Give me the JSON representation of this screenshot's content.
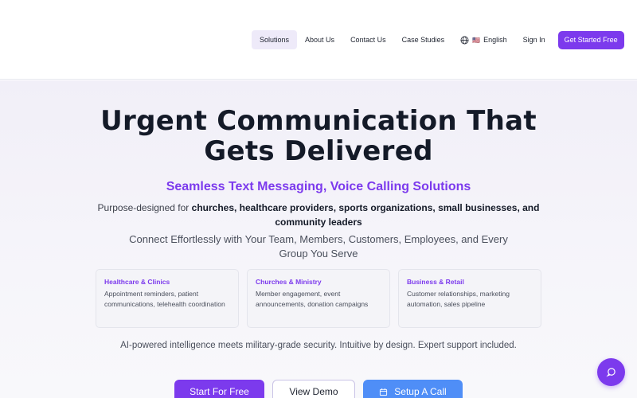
{
  "nav": {
    "items": [
      {
        "label": "Solutions",
        "active": true
      },
      {
        "label": "About Us"
      },
      {
        "label": "Contact Us"
      },
      {
        "label": "Case Studies"
      }
    ],
    "language": {
      "label": "English",
      "flag": "🇺🇸"
    },
    "sign_in": "Sign In",
    "get_started": "Get Started Free"
  },
  "hero": {
    "title_line1": "Urgent Communication That",
    "title_line2": "Gets Delivered",
    "subtitle": "Seamless Text Messaging, Voice Calling Solutions",
    "purpose_prefix": "Purpose-designed for",
    "purpose_bold": "churches, healthcare providers, sports organizations, small businesses, and community leaders",
    "connect": "Connect Effortlessly with Your Team, Members, Customers, Employees, and Every Group You Serve",
    "cards": [
      {
        "title": "Healthcare & Clinics",
        "desc": "Appointment reminders, patient communications, telehealth coordination"
      },
      {
        "title": "Churches & Ministry",
        "desc": "Member engagement, event announcements, donation campaigns"
      },
      {
        "title": "Business & Retail",
        "desc": "Customer relationships, marketing automation, sales pipeline"
      }
    ],
    "ai_text": "AI-powered intelligence meets military-grade security. Intuitive by design. Expert support included.",
    "buttons": {
      "start": "Start For Free",
      "demo": "View Demo",
      "call": "Setup A Call"
    }
  },
  "colors": {
    "accent": "#7c3aed",
    "call_button": "#4f8ef7"
  },
  "icons": {
    "language": "globe-icon",
    "call": "calendar-icon",
    "chat": "chat-bubble-icon"
  }
}
